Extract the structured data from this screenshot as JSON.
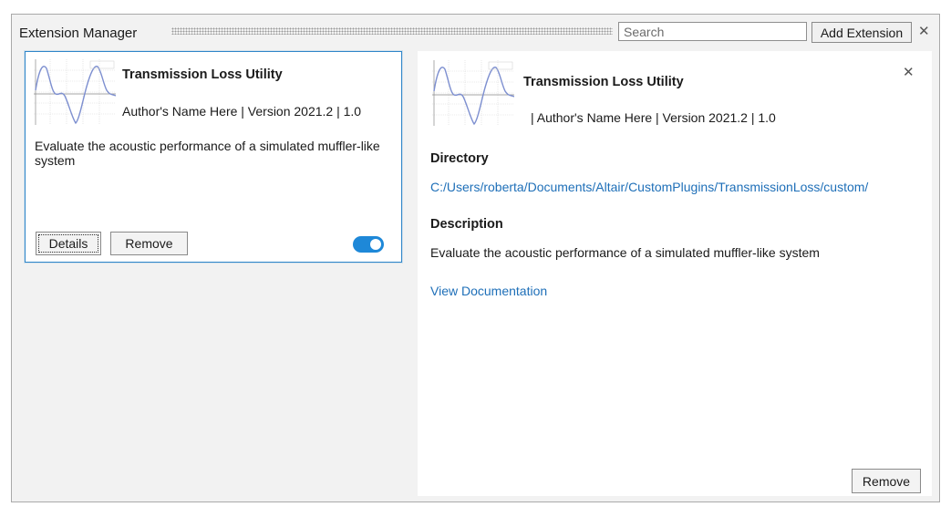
{
  "window": {
    "title": "Extension Manager",
    "search_placeholder": "Search",
    "add_extension_label": "Add Extension",
    "close_glyph": "✕"
  },
  "card": {
    "title": "Transmission Loss Utility",
    "author_version": "Author's Name Here | Version 2021.2 | 1.0",
    "description": "Evaluate the acoustic performance of a simulated muffler-like system",
    "details_label": "Details",
    "remove_label": "Remove",
    "enabled": true,
    "toggle_color": "#1e88d8"
  },
  "detail": {
    "title": "Transmission Loss Utility",
    "author_version": "| Author's Name Here | Version 2021.2 | 1.0",
    "directory_heading": "Directory",
    "directory_path": "C:/Users/roberta/Documents/Altair/CustomPlugins/TransmissionLoss/custom/",
    "description_heading": "Description",
    "description": "Evaluate the acoustic performance of a simulated muffler-like system",
    "doc_link": "View Documentation",
    "remove_label": "Remove",
    "close_glyph": "✕",
    "link_color": "#1e6fb8"
  },
  "icons": {
    "thumbnail": "plot-thumbnail-icon",
    "close": "close-icon",
    "toggle": "toggle-switch"
  }
}
